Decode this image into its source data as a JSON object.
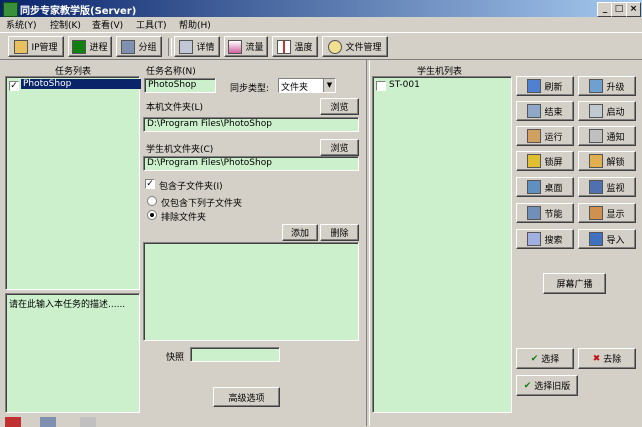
{
  "window": {
    "title": "同步专家教学版(Server)"
  },
  "menu": [
    "系统(Y)",
    "控制(K)",
    "查看(V)",
    "工具(T)",
    "帮助(H)"
  ],
  "toolbar": {
    "ip": "IP管理",
    "process": "进程",
    "group": "分组",
    "detail": "详情",
    "traffic": "流量",
    "temperature": "温度",
    "file_mgr": "文件管理"
  },
  "left": {
    "task_list_label": "任务列表",
    "tasks": [
      "PhotoShop"
    ],
    "desc_text": "请在此输入本任务的描述......"
  },
  "form": {
    "task_name_label": "任务名称(N)",
    "task_name": "PhotoShop",
    "sync_type_label": "同步类型:",
    "sync_type": "文件夹",
    "local_folder_label": "本机文件夹(L)",
    "local_folder": "D:\\Program Files\\PhotoShop",
    "student_folder_label": "学生机文件夹(C)",
    "student_folder": "D:\\Program Files\\PhotoShop",
    "browse": "浏览",
    "include_sub": "包含子文件夹(I)",
    "only_sub": "仅包含下列子文件夹",
    "exclude": "排除文件夹",
    "add": "添加",
    "delete": "删除",
    "snapshot_label": "快照",
    "advanced": "高级选项"
  },
  "student": {
    "list_label": "学生机列表",
    "items": [
      "ST-001"
    ]
  },
  "actions": {
    "refresh": "刷新",
    "upgrade": "升级",
    "end": "结束",
    "start": "启动",
    "run": "运行",
    "notify": "通知",
    "lock": "锁屏",
    "unlock": "解锁",
    "desktop": "桌面",
    "monitor": "监视",
    "power": "节能",
    "display": "显示",
    "search": "搜索",
    "import": "导入",
    "broadcast": "屏幕广播",
    "select": "选择",
    "remove": "去除",
    "select_old": "选择旧版"
  }
}
